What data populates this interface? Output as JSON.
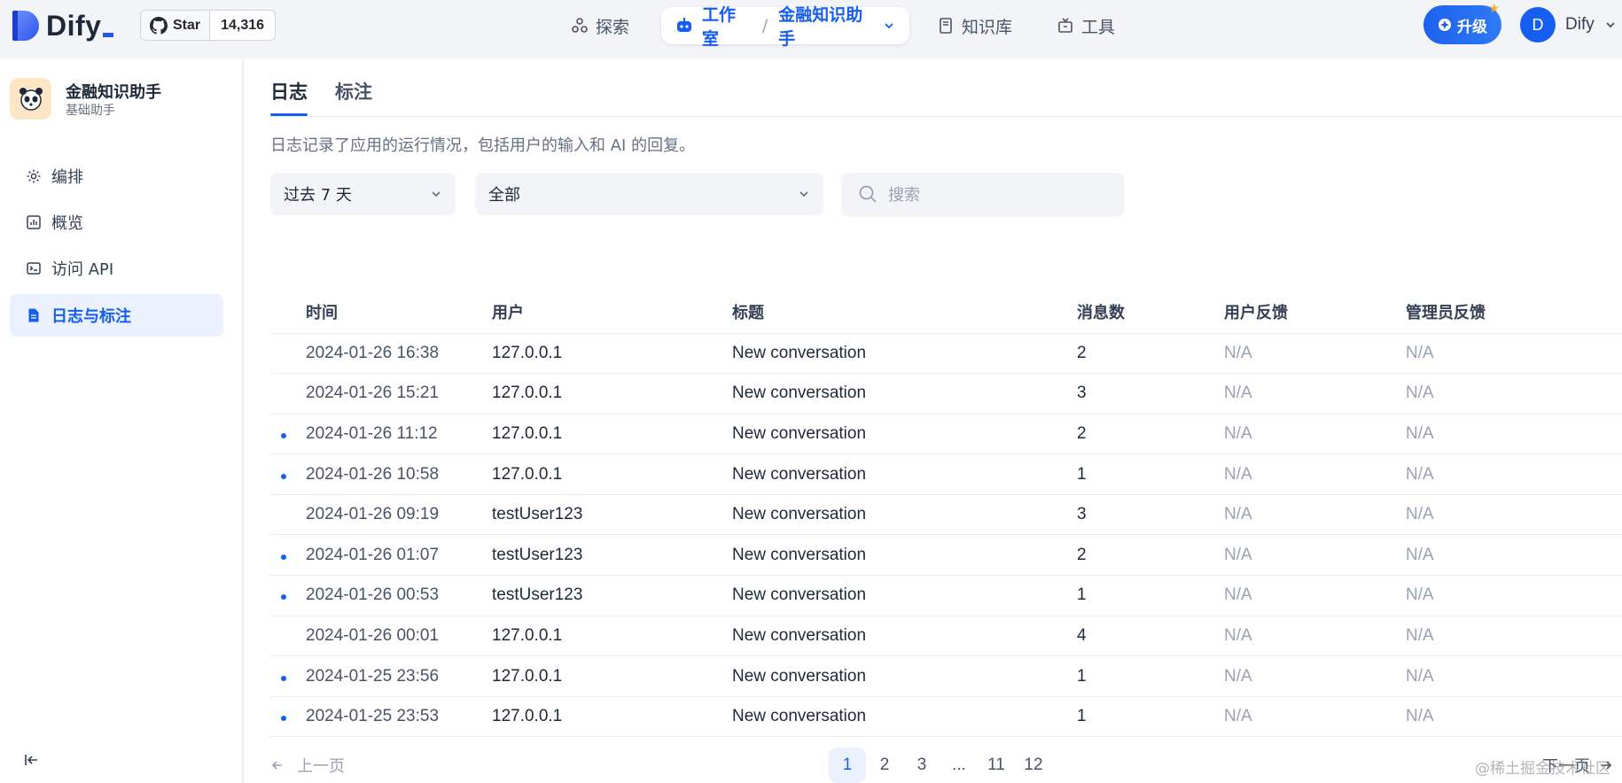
{
  "brand": {
    "name": "Dify"
  },
  "github": {
    "star_label": "Star",
    "star_count": "14,316"
  },
  "nav": {
    "explore": "探索",
    "studio": "工作室",
    "current_app": "金融知识助手",
    "knowledge": "知识库",
    "tools": "工具"
  },
  "account": {
    "upgrade_label": "升级",
    "avatar_initial": "D",
    "user_name": "Dify"
  },
  "sidebar": {
    "app_name": "金融知识助手",
    "app_type": "基础助手",
    "items": [
      {
        "label": "编排",
        "icon": "gear-icon"
      },
      {
        "label": "概览",
        "icon": "chart-icon"
      },
      {
        "label": "访问 API",
        "icon": "terminal-icon"
      },
      {
        "label": "日志与标注",
        "icon": "document-icon",
        "active": true
      }
    ]
  },
  "main": {
    "tabs": [
      {
        "label": "日志",
        "active": true
      },
      {
        "label": "标注",
        "active": false
      }
    ],
    "description": "日志记录了应用的运行情况，包括用户的输入和 AI 的回复。",
    "filters": {
      "period": "过去 7 天",
      "status": "全部",
      "search_placeholder": "搜索"
    },
    "table": {
      "columns": [
        "时间",
        "用户",
        "标题",
        "消息数",
        "用户反馈",
        "管理员反馈"
      ],
      "rows": [
        {
          "unread": false,
          "time": "2024-01-26 16:38",
          "user": "127.0.0.1",
          "title": "New conversation",
          "messages": "2",
          "user_feedback": "N/A",
          "admin_feedback": "N/A"
        },
        {
          "unread": false,
          "time": "2024-01-26 15:21",
          "user": "127.0.0.1",
          "title": "New conversation",
          "messages": "3",
          "user_feedback": "N/A",
          "admin_feedback": "N/A"
        },
        {
          "unread": true,
          "time": "2024-01-26 11:12",
          "user": "127.0.0.1",
          "title": "New conversation",
          "messages": "2",
          "user_feedback": "N/A",
          "admin_feedback": "N/A"
        },
        {
          "unread": true,
          "time": "2024-01-26 10:58",
          "user": "127.0.0.1",
          "title": "New conversation",
          "messages": "1",
          "user_feedback": "N/A",
          "admin_feedback": "N/A"
        },
        {
          "unread": false,
          "time": "2024-01-26 09:19",
          "user": "testUser123",
          "title": "New conversation",
          "messages": "3",
          "user_feedback": "N/A",
          "admin_feedback": "N/A"
        },
        {
          "unread": true,
          "time": "2024-01-26 01:07",
          "user": "testUser123",
          "title": "New conversation",
          "messages": "2",
          "user_feedback": "N/A",
          "admin_feedback": "N/A"
        },
        {
          "unread": true,
          "time": "2024-01-26 00:53",
          "user": "testUser123",
          "title": "New conversation",
          "messages": "1",
          "user_feedback": "N/A",
          "admin_feedback": "N/A"
        },
        {
          "unread": false,
          "time": "2024-01-26 00:01",
          "user": "127.0.0.1",
          "title": "New conversation",
          "messages": "4",
          "user_feedback": "N/A",
          "admin_feedback": "N/A"
        },
        {
          "unread": true,
          "time": "2024-01-25 23:56",
          "user": "127.0.0.1",
          "title": "New conversation",
          "messages": "1",
          "user_feedback": "N/A",
          "admin_feedback": "N/A"
        },
        {
          "unread": true,
          "time": "2024-01-25 23:53",
          "user": "127.0.0.1",
          "title": "New conversation",
          "messages": "1",
          "user_feedback": "N/A",
          "admin_feedback": "N/A"
        }
      ]
    },
    "pagination": {
      "prev_label": "上一页",
      "next_label": "下一页",
      "pages": [
        "1",
        "2",
        "3",
        "...",
        "11",
        "12"
      ],
      "current": "1"
    }
  },
  "watermark": "@稀土掘金技术社区",
  "colors": {
    "accent": "#155eef",
    "active_bg": "#ebf1ff",
    "muted": "#98a2b3"
  }
}
